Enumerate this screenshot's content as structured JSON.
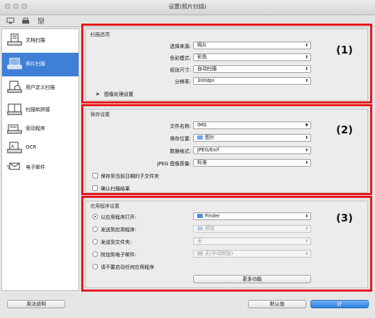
{
  "window": {
    "title": "设置(照片扫描)"
  },
  "sidebar": {
    "items": [
      {
        "label": "文档扫描",
        "icon": "document-scan-icon",
        "selected": false
      },
      {
        "label": "照片扫描",
        "icon": "photo-scan-icon",
        "selected": true
      },
      {
        "label": "用户定义扫描",
        "icon": "custom-scan-icon",
        "selected": false
      },
      {
        "label": "扫描和拼接",
        "icon": "scan-stitch-icon",
        "selected": false
      },
      {
        "label": "驱动程序",
        "icon": "driver-icon",
        "selected": false
      },
      {
        "label": "OCR",
        "icon": "ocr-icon",
        "selected": false
      },
      {
        "label": "电子邮件",
        "icon": "email-icon",
        "selected": false
      }
    ]
  },
  "scan_options": {
    "title": "扫描选项",
    "number": "(1)",
    "fields": [
      {
        "label": "选择来源:",
        "value": "照片"
      },
      {
        "label": "色彩模式:",
        "value": "彩色"
      },
      {
        "label": "纸张尺寸:",
        "value": "自动扫描"
      },
      {
        "label": "分辨率:",
        "value": "300dpi"
      }
    ],
    "image_processing": "图像处理设置"
  },
  "save_settings": {
    "title": "保存设置",
    "number": "(2)",
    "filename_label": "文件名称:",
    "filename_value": "IMG",
    "location_label": "保存位置:",
    "location_value": "图片",
    "format_label": "数据格式:",
    "format_value": "JPEG/Exif",
    "quality_label": "JPEG 图像质量:",
    "quality_value": "标准",
    "subfolder_label": "保存到当前日期的子文件夹",
    "confirm_label": "确认扫描结果"
  },
  "app_settings": {
    "title": "应用程序设置",
    "number": "(3)",
    "options": [
      {
        "label": "以应用程序打开:",
        "value": "Finder",
        "checked": true,
        "enabled": true
      },
      {
        "label": "发送到应用程序:",
        "value": "预览",
        "checked": false,
        "enabled": false
      },
      {
        "label": "发送到文件夹:",
        "value": "无",
        "checked": false,
        "enabled": false
      },
      {
        "label": "附加到电子邮件:",
        "value": "无(手动附加)",
        "checked": false,
        "enabled": false
      },
      {
        "label": "请不要启动任何应用程序",
        "checked": false
      }
    ],
    "more_button": "更多功能"
  },
  "footer": {
    "help": "用法说明",
    "defaults": "默认值",
    "ok": "好"
  },
  "colors": {
    "accent": "#3f7fd6",
    "highlight_border": "#e8141a"
  }
}
